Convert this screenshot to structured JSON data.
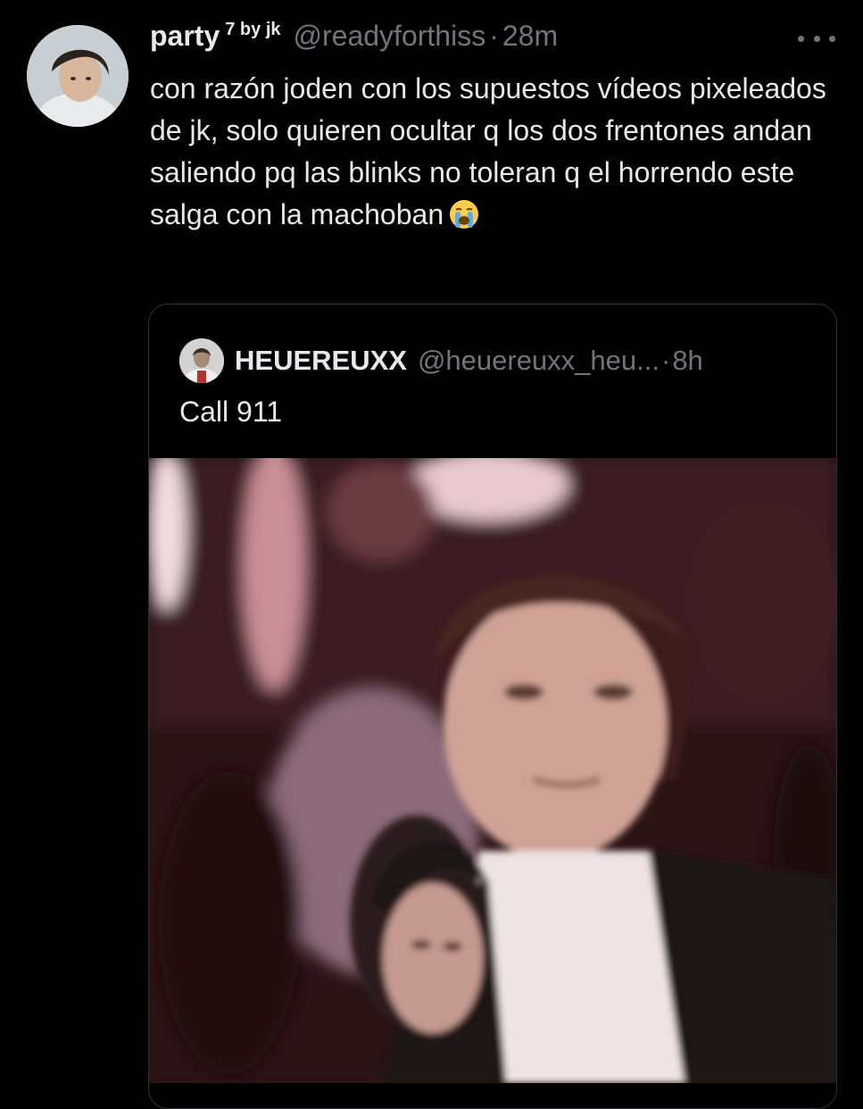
{
  "tweet": {
    "display_name": "party",
    "name_badge": "7 by jk",
    "handle": "@readyforthiss",
    "separator": "·",
    "time": "28m",
    "text": "con razón joden con los supuestos vídeos pixeleados de jk, solo quieren ocultar q los dos frentones andan saliendo pq las blinks no toleran q el horrendo este salga con la machoban",
    "emoji": "loudly-crying-face-emoji"
  },
  "quoted_tweet": {
    "display_name": "HEUEREUXX",
    "handle": "@heuereuxx_heu...",
    "separator": "·",
    "time": "8h",
    "text": "Call 911"
  },
  "icons": {
    "more": "more-horizontal-icon"
  },
  "colors": {
    "background": "#000000",
    "primary_text": "#e7e9ea",
    "secondary_text": "#71767b",
    "border": "#2f3336"
  }
}
